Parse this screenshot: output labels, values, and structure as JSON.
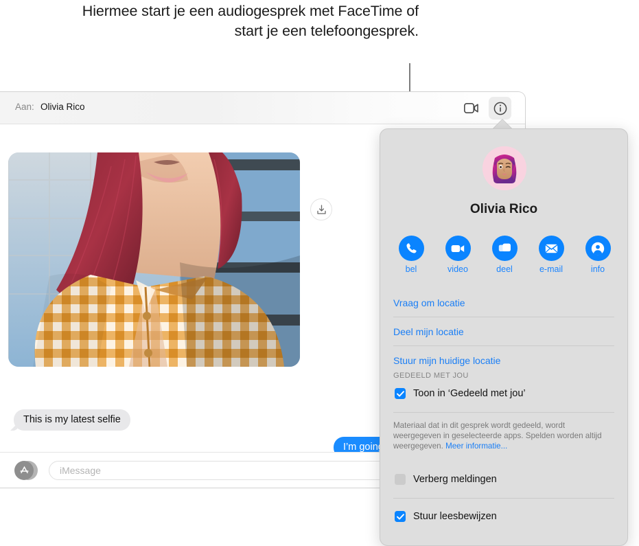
{
  "callout": {
    "text": "Hiermee start je een audiogesprek met FaceTime of start je een telefoongesprek."
  },
  "window": {
    "toolbar": {
      "to_label": "Aan:",
      "to_value": "Olivia Rico",
      "video_icon": "video-camera-icon",
      "info_icon": "info-circle-icon"
    },
    "conversation": {
      "photo_alt": "selfie-photo",
      "save_icon": "download-to-tray-icon",
      "incoming_message": "This is my latest selfie",
      "outgoing_message": "I’m going"
    },
    "composer": {
      "apps_icon": "app-store-icon",
      "input_placeholder": "iMessage",
      "input_value": ""
    }
  },
  "popover": {
    "avatar_alt": "memoji-avatar",
    "contact_name": "Olivia Rico",
    "actions": [
      {
        "label": "bel",
        "icon": "phone-icon"
      },
      {
        "label": "video",
        "icon": "video-camera-icon"
      },
      {
        "label": "deel",
        "icon": "screen-share-icon"
      },
      {
        "label": "e-mail",
        "icon": "envelope-icon"
      },
      {
        "label": "info",
        "icon": "person-circle-icon"
      }
    ],
    "links": [
      "Vraag om locatie",
      "Deel mijn locatie",
      "Stuur mijn huidige locatie"
    ],
    "section_header": "GEDEELD MET JOU",
    "shared_checkbox": {
      "label": "Toon in ‘Gedeeld met jou’",
      "checked": true
    },
    "fineprint": {
      "text": "Materiaal dat in dit gesprek wordt gedeeld, wordt weergegeven in geselecteerde apps. Spelden worden altijd weergegeven. ",
      "link": "Meer informatie..."
    },
    "hide_alerts": {
      "label": "Verberg meldingen",
      "checked": false
    },
    "read_receipts": {
      "label": "Stuur leesbewijzen",
      "checked": true
    }
  },
  "colors": {
    "accent_blue": "#0a84ff",
    "link_blue": "#1a7ef5",
    "bubble_out": "#1a8cff",
    "bubble_in": "#e8e8ea",
    "popover_bg": "#dedede"
  }
}
